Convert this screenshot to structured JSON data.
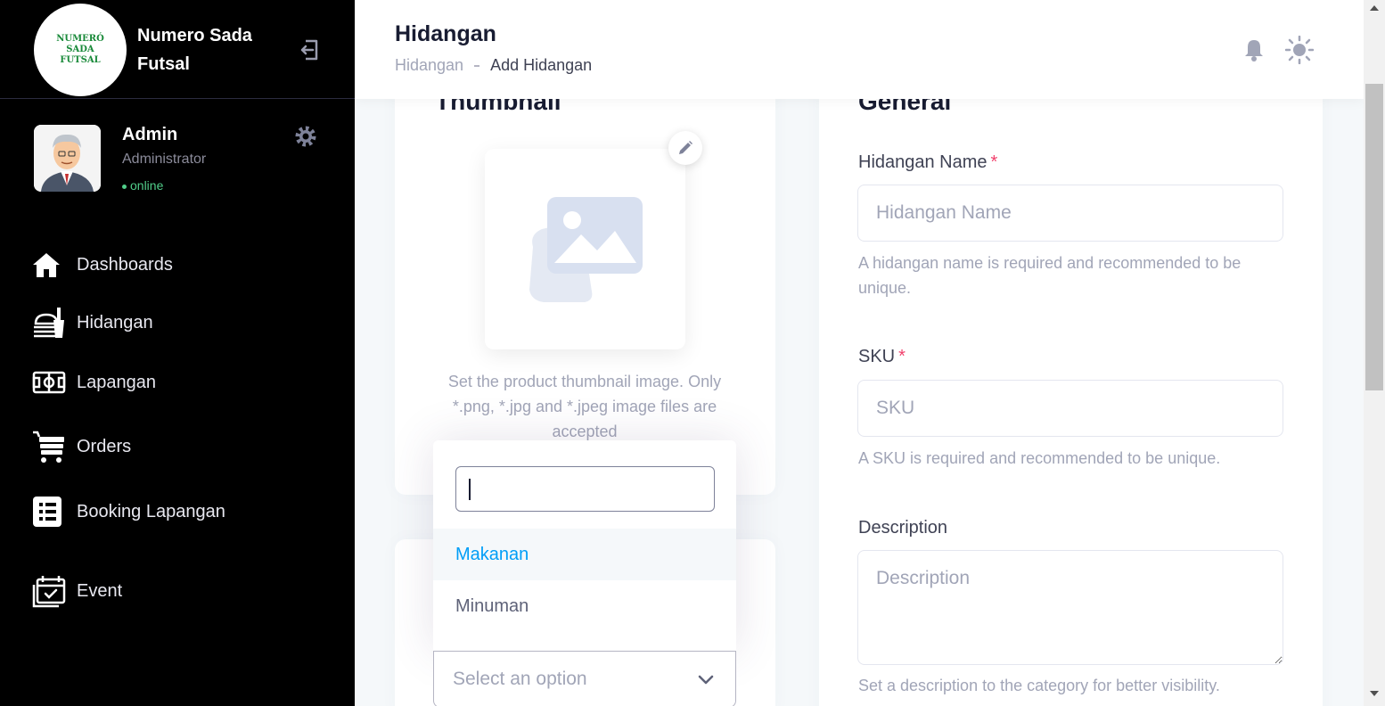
{
  "brand": {
    "name": "Numero Sada Futsal",
    "logo_text": "NUMERO SADA FUTSAL"
  },
  "user": {
    "name": "Admin",
    "role": "Administrator",
    "status": "online"
  },
  "nav": [
    {
      "label": "Dashboards",
      "icon": "home-icon"
    },
    {
      "label": "Hidangan",
      "icon": "food-icon"
    },
    {
      "label": "Lapangan",
      "icon": "field-icon"
    },
    {
      "label": "Orders",
      "icon": "cart-icon"
    },
    {
      "label": "Booking Lapangan",
      "icon": "list-icon"
    },
    {
      "label": "Event",
      "icon": "calendar-icon"
    }
  ],
  "header": {
    "title": "Hidangan",
    "breadcrumb": [
      "Hidangan",
      "Add Hidangan"
    ]
  },
  "thumbnail": {
    "title": "Thumbnail",
    "hint": "Set the product thumbnail image. Only *.png, *.jpg and *.jpeg image files are accepted"
  },
  "category": {
    "search_value": "",
    "options": [
      "Makanan",
      "Minuman"
    ],
    "highlighted": "Makanan",
    "placeholder": "Select an option"
  },
  "general": {
    "title": "General",
    "name_label": "Hidangan Name",
    "name_placeholder": "Hidangan Name",
    "name_hint": "A hidangan name is required and recommended to be unique.",
    "sku_label": "SKU",
    "sku_placeholder": "SKU",
    "sku_hint": "A SKU is required and recommended to be unique.",
    "description_label": "Description",
    "description_placeholder": "Description",
    "description_hint": "Set a description to the category for better visibility.",
    "required_mark": "*"
  },
  "colors": {
    "sidebar": "#000000",
    "accent": "#009ef7",
    "required": "#f1416c",
    "online": "#50cd89"
  }
}
